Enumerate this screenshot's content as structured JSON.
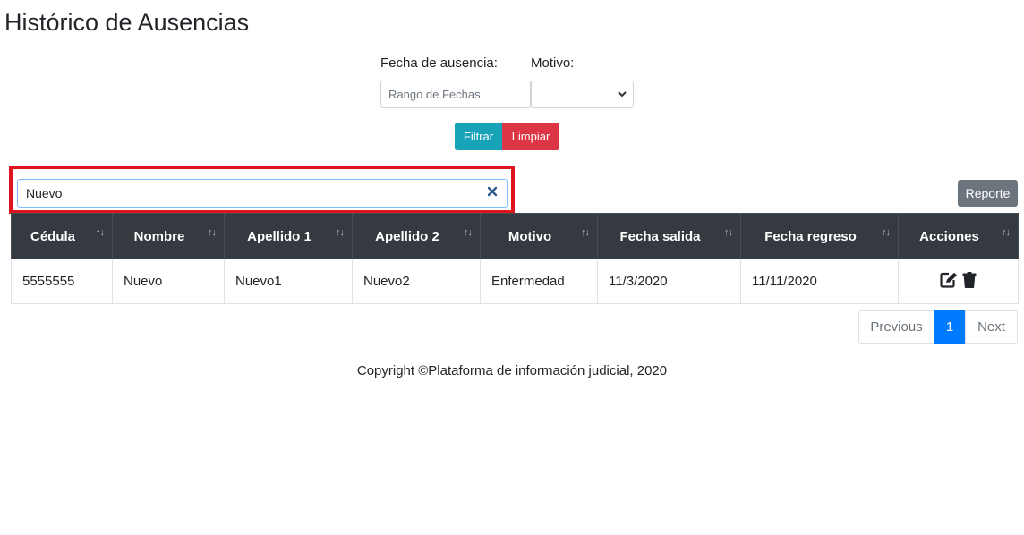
{
  "page": {
    "title": "Histórico de Ausencias"
  },
  "filters": {
    "date_label": "Fecha de ausencia:",
    "date_placeholder": "Rango de Fechas",
    "motivo_label": "Motivo:",
    "motivo_value": "",
    "filter_button": "Filtrar",
    "clear_button": "Limpiar"
  },
  "search": {
    "value": "Nuevo",
    "clear_icon": "close-icon"
  },
  "report_button": "Reporte",
  "table": {
    "headers": [
      "Cédula",
      "Nombre",
      "Apellido 1",
      "Apellido 2",
      "Motivo",
      "Fecha salida",
      "Fecha regreso",
      "Acciones"
    ],
    "sorted_column": "Cédula",
    "rows": [
      {
        "cedula": "5555555",
        "nombre": "Nuevo",
        "apellido1": "Nuevo1",
        "apellido2": "Nuevo2",
        "motivo": "Enfermedad",
        "fecha_salida": "11/3/2020",
        "fecha_regreso": "11/11/2020",
        "actions": [
          "edit-icon",
          "trash-icon"
        ]
      }
    ]
  },
  "pagination": {
    "previous": "Previous",
    "current": "1",
    "next": "Next"
  },
  "footer": {
    "copyright": "Copyright ©Plataforma de información judicial, 2020"
  },
  "colors": {
    "filter_button": "#17a2b8",
    "clear_button": "#dc3545",
    "report_button": "#6c757d",
    "table_header": "#343a40",
    "active_page": "#007bff",
    "highlight": "#e0141e"
  }
}
